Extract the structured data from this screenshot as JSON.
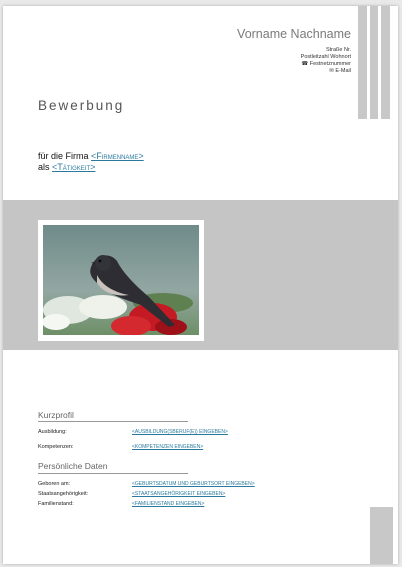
{
  "header": {
    "name": "Vorname Nachname",
    "contact": [
      "Straße Nr.",
      "Postleitzahl Wohnort",
      "☎ Festnetznummer",
      "✉ E-Mail"
    ]
  },
  "heading": "Bewerbung",
  "firm": {
    "line1_prefix": "für die Firma ",
    "company_placeholder": "<Firmenname>",
    "line2_prefix": "als ",
    "job_placeholder": "<Tätigkeit>"
  },
  "photo": {
    "subject": "bird on red flowers"
  },
  "kurzprofil": {
    "title": "Kurzprofil",
    "rows": [
      {
        "label": "Ausbildung:",
        "value": "<AUSBILDUNG(SBERUF(E)) EINGEBEN>"
      },
      {
        "label": "Kompetenzen:",
        "value": "<KOMPETENZEN EINGEBEN>"
      }
    ]
  },
  "personal": {
    "title": "Persönliche Daten",
    "rows": [
      {
        "label": "Geboren am:",
        "value": "<GEBURTSDATUM UND GEBURTSORT EINGEBEN>"
      },
      {
        "label": "Staatsangehörigkeit:",
        "value": "<STAATSANGEHÖRIGKEIT EINGEBEN>"
      },
      {
        "label": "Familienstand:",
        "value": "<FAMILIENSTAND EINGEBEN>"
      }
    ]
  },
  "colors": {
    "accent": "#2a7aa0",
    "band": "#c5c5c5",
    "bars": "#c8c8c8"
  }
}
